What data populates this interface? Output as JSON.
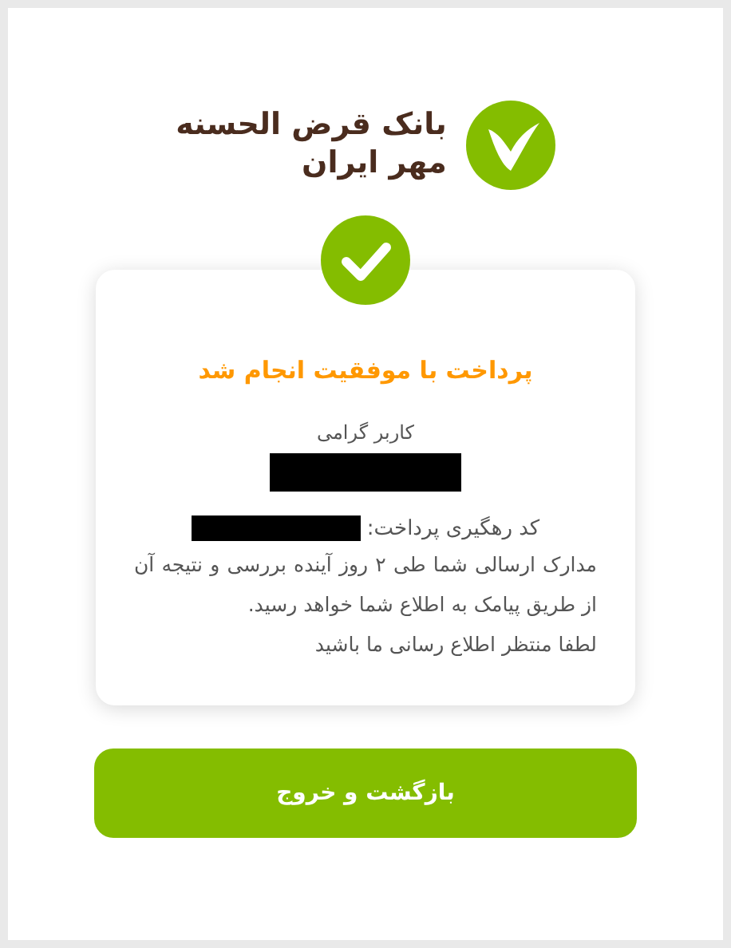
{
  "logo": {
    "line_1": "بانک قرض الحسنه",
    "line_2": "مهر ایران"
  },
  "result": {
    "succeeded": true,
    "title": "پرداخت با موفقیت انجام شد",
    "greeting": "کاربر گرامی",
    "tracking_label": "کد رهگیری پرداخت:",
    "message": "مدارک ارسالی شما طی ۲ روز آینده بررسی و نتیجه آن از طریق پیامک به اطلاع شما خواهد رسید.",
    "note": "لطفا منتظر اطلاع رسانی ما باشید"
  },
  "buttons": [
    {
      "label": "بازگشت و خروج"
    }
  ]
}
